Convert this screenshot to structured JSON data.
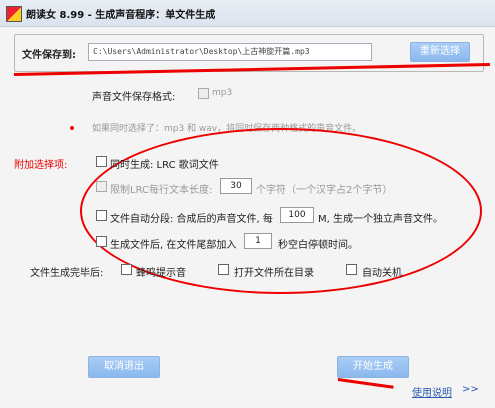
{
  "window": {
    "title": "朗读女 8.99 - 生成声音程序：单文件生成"
  },
  "save_group": {
    "label": "文件保存到:",
    "path": "C:\\Users\\Administrator\\Desktop\\上古神旋开篇.mp3",
    "browse_button": "重新选择"
  },
  "format": {
    "label": "声音文件保存格式:",
    "value": "mp3"
  },
  "hint": "如果同时选择了：mp3 和 wav，将同时保存两种格式的声音文件。",
  "options": {
    "label": "附加选择项:",
    "lrc": "同时生成: LRC 歌词文件",
    "limit_prefix": "限制LRC每行文本长度:",
    "limit_value": "30",
    "limit_suffix": "个字符（一个汉字占2个字节）",
    "split_prefix": "文件自动分段: 合成后的声音文件, 每",
    "split_value": "100",
    "split_suffix": "M, 生成一个独立声音文件。",
    "silence_prefix": "生成文件后, 在文件尾部加入",
    "silence_value": "1",
    "silence_suffix": "秒空白停顿时间。"
  },
  "after": {
    "label": "文件生成完毕后:",
    "beep": "蜂鸣提示音",
    "open_dir": "打开文件所在目录",
    "shutdown": "自动关机"
  },
  "buttons": {
    "cancel": "取消退出",
    "start": "开始生成",
    "help": "使用说明"
  },
  "colors": {
    "accent": "#8ab8ee",
    "annotation": "#e00000"
  }
}
